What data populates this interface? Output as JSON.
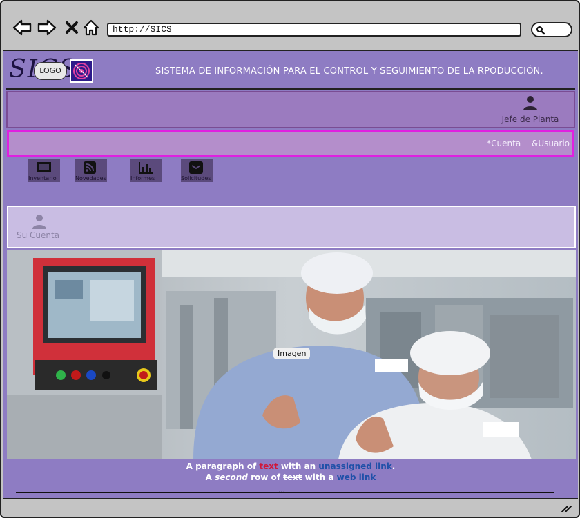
{
  "browser": {
    "url": "http://SICS",
    "back_icon": "arrow-left-icon",
    "forward_icon": "arrow-right-icon",
    "close_icon": "close-icon",
    "home_icon": "home-icon",
    "search_icon": "search-icon"
  },
  "header": {
    "brand_text": "SICS",
    "logo_text": "LOGO",
    "title": "SISTEMA DE INFORMACIÓN PARA EL CONTROL Y SEGUIMIENTO DE LA RPODUCCIÓN."
  },
  "role_bar": {
    "user_icon": "user-icon",
    "label": "Jefe de Planta"
  },
  "account_bar": {
    "cuenta": "*Cuenta",
    "usuario": "&Usuario"
  },
  "quick_nav": [
    {
      "label": "Inventario",
      "icon": "list-icon"
    },
    {
      "label": "Novedades",
      "icon": "rss-icon"
    },
    {
      "label": "Informes",
      "icon": "bar-chart-icon"
    },
    {
      "label": "Solicitudes",
      "icon": "envelope-icon"
    }
  ],
  "account_panel": {
    "icon": "user-icon",
    "label": "Su Cuenta"
  },
  "hero": {
    "tag": "Imagen"
  },
  "footer": {
    "line1_a": "A paragraph of ",
    "line1_link_red": "text",
    "line1_b": " with an ",
    "line1_link_blue": "unassigned link",
    "line1_c": ".",
    "line2_a": "A ",
    "line2_em": "second",
    "line2_b": " row of ",
    "line2_strike": "text",
    "line2_c": " with a ",
    "line2_link": "web link",
    "ellipsis": "..."
  },
  "colors": {
    "page_bg": "#8e7cc3",
    "account_bar_border": "#e020e0",
    "red_link": "#d0163a",
    "blue_link": "#1f50a8"
  }
}
